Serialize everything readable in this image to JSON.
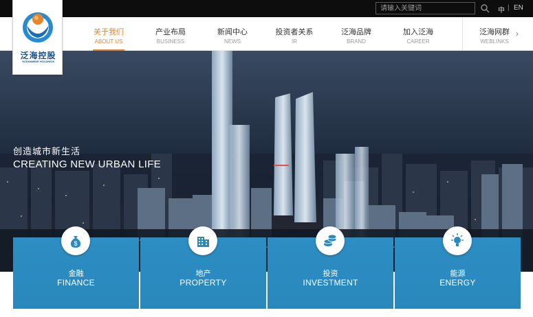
{
  "header": {
    "search_placeholder": "请输入关键词",
    "lang_zh": "中",
    "lang_sep": "|",
    "lang_en": "EN"
  },
  "logo": {
    "name_cn": "泛海控股",
    "name_en": "OCEANWIDE HOLDINGS"
  },
  "nav": {
    "items": [
      {
        "cn": "关于我们",
        "en": "ABOUT US",
        "active": true
      },
      {
        "cn": "产业布局",
        "en": "BUSINESS"
      },
      {
        "cn": "新闻中心",
        "en": "NEWS"
      },
      {
        "cn": "投资者关系",
        "en": "IR"
      },
      {
        "cn": "泛海品牌",
        "en": "BRAND"
      },
      {
        "cn": "加入泛海",
        "en": "CAREER"
      },
      {
        "cn": "泛海网群",
        "en": "WEBLINKS"
      }
    ],
    "more_icon": "chevron-right-icon"
  },
  "hero": {
    "slogan_cn": "创造城市新生活",
    "slogan_en": "CREATING NEW URBAN LIFE"
  },
  "cards": [
    {
      "cn": "金融",
      "en": "FINANCE",
      "icon": "money-bag-icon"
    },
    {
      "cn": "地产",
      "en": "PROPERTY",
      "icon": "building-icon"
    },
    {
      "cn": "投资",
      "en": "INVESTMENT",
      "icon": "coins-icon"
    },
    {
      "cn": "能源",
      "en": "ENERGY",
      "icon": "lightbulb-icon"
    }
  ],
  "colors": {
    "accent": "#e8842a",
    "card_blue": "#2a8ac0",
    "brand_blue": "#1b4f8a"
  }
}
